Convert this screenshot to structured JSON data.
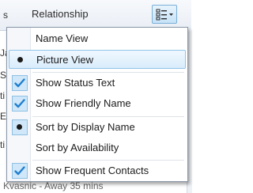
{
  "header": {
    "left_fragment": "s",
    "relationship_label": "Relationship"
  },
  "background_rows": [
    "Ja",
    "Sa",
    "ti",
    "E",
    "ti",
    "Kvasnic"
  ],
  "status_bar": {
    "text": "Kvasnic - Away 35 mins"
  },
  "menu": {
    "items": [
      {
        "label": "Name View",
        "state": "none"
      },
      {
        "label": "Picture View",
        "state": "radio"
      },
      {
        "label": "Show Status Text",
        "state": "check"
      },
      {
        "label": "Show Friendly Name",
        "state": "check"
      },
      {
        "label": "Sort by Display Name",
        "state": "radio"
      },
      {
        "label": "Sort by Availability",
        "state": "none"
      },
      {
        "label": "Show Frequent Contacts",
        "state": "check"
      }
    ]
  },
  "colors": {
    "accent": "#1f7fd0",
    "highlight_border": "#92c3e8",
    "check_box_fill": "#cfe7f8"
  },
  "icons": {
    "view_button": "view-options-icon",
    "dropdown_arrow": "chevron-down-icon",
    "check": "checkmark-icon",
    "radio": "radio-dot-icon"
  }
}
